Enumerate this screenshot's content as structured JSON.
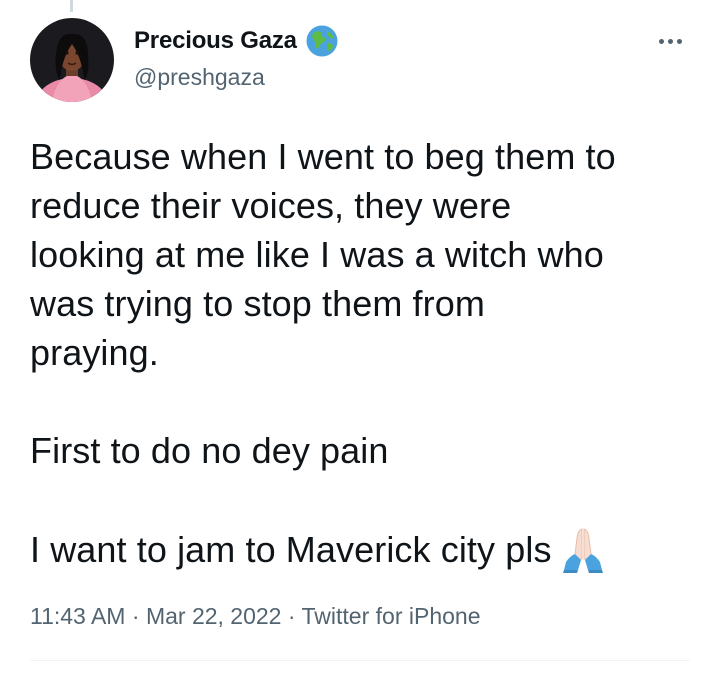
{
  "tweet": {
    "author": {
      "display_name": "Precious Gaza",
      "handle": "@preshgaza",
      "verified_badge_icon": "globe-icon"
    },
    "more_menu_icon": "more-horizontal-icon",
    "paragraphs": [
      [
        "Because when I went to beg them to",
        "reduce their voices, they were",
        "looking at me like I was a witch who",
        "was trying to stop them from",
        "praying."
      ],
      [
        "First to do no dey pain"
      ],
      [
        "I want to jam to Maverick city pls"
      ]
    ],
    "emoji": "folded-hands-icon",
    "time": "11:43 AM",
    "date": "Mar 22, 2022",
    "separator": "·",
    "source": "Twitter for iPhone"
  },
  "colors": {
    "text_primary": "#0f1419",
    "text_secondary": "#536471",
    "divider": "#eff3f4"
  }
}
